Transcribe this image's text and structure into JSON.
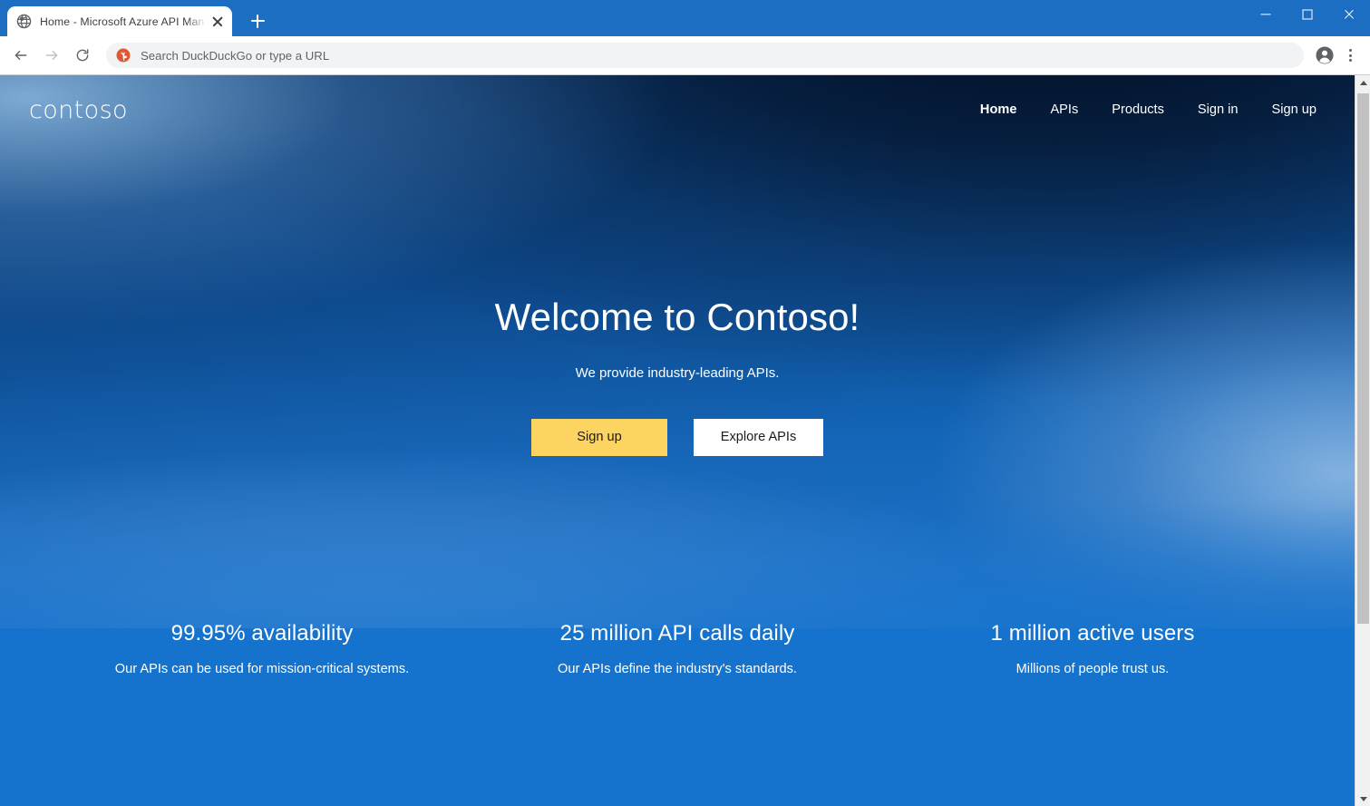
{
  "browser": {
    "tab": {
      "title": "Home - Microsoft Azure API Man",
      "favicon_icon": "globe-icon",
      "close_icon": "close-icon"
    },
    "new_tab_icon": "plus-icon",
    "window_controls": {
      "minimize_icon": "minimize-icon",
      "maximize_icon": "maximize-icon",
      "close_icon": "close-icon"
    },
    "toolbar": {
      "back_icon": "arrow-back-icon",
      "forward_icon": "arrow-forward-icon",
      "reload_icon": "reload-icon",
      "profile_icon": "account-avatar-icon",
      "menu_icon": "three-dots-menu-icon",
      "omnibox": {
        "search_engine_icon": "duckduckgo-icon",
        "value": "",
        "placeholder": "Search DuckDuckGo or type a URL"
      }
    },
    "scrollbar": {
      "up_arrow_icon": "scroll-up-arrow-icon",
      "down_arrow_icon": "scroll-down-arrow-icon"
    }
  },
  "site": {
    "logo_text": "contoso",
    "nav": [
      {
        "label": "Home",
        "active": true
      },
      {
        "label": "APIs",
        "active": false
      },
      {
        "label": "Products",
        "active": false
      },
      {
        "label": "Sign in",
        "active": false
      },
      {
        "label": "Sign up",
        "active": false
      }
    ],
    "hero": {
      "heading": "Welcome to Contoso!",
      "subheading": "We provide industry-leading APIs.",
      "primary_button": "Sign up",
      "secondary_button": "Explore APIs"
    },
    "stats": [
      {
        "headline": "99.95% availability",
        "description": "Our APIs can be used for mission-critical systems."
      },
      {
        "headline": "25 million API calls daily",
        "description": "Our APIs define the industry's standards."
      },
      {
        "headline": "1 million active users",
        "description": "Millions of people trust us."
      }
    ]
  },
  "colors": {
    "browser_tabstrip": "#1b6ec2",
    "hero_dark": "#071a33",
    "hero_blue": "#1573cd",
    "accent_yellow": "#fcd462",
    "text_on_dark": "#ffffff"
  }
}
